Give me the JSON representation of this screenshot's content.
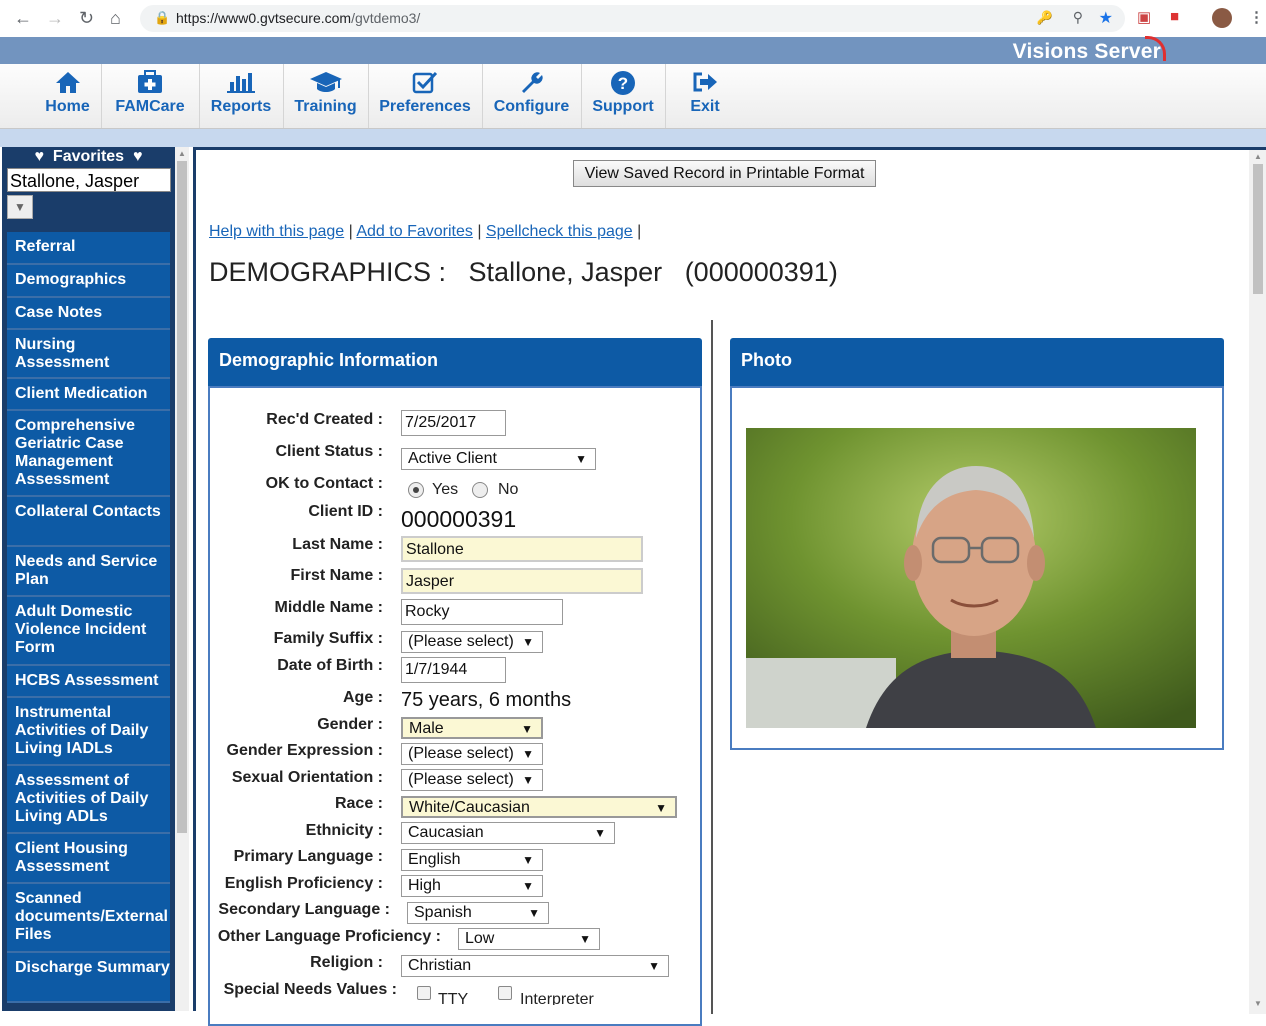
{
  "browser": {
    "url_host": "https://www0.gvtsecure.com",
    "url_path": "/gvtdemo3/"
  },
  "banner": {
    "brand": "Visions Server"
  },
  "toolbar": [
    {
      "label": "Home",
      "icon": "home-icon"
    },
    {
      "label": "FAMCare",
      "icon": "medkit-icon"
    },
    {
      "label": "Reports",
      "icon": "bar-chart-icon"
    },
    {
      "label": "Training",
      "icon": "graduation-cap-icon"
    },
    {
      "label": "Preferences",
      "icon": "checkbox-icon"
    },
    {
      "label": "Configure",
      "icon": "wrench-icon"
    },
    {
      "label": "Support",
      "icon": "question-icon"
    },
    {
      "label": "Exit",
      "icon": "exit-icon"
    }
  ],
  "favorites": {
    "title": "Favorites",
    "value": "Stallone, Jasper"
  },
  "sidebar": {
    "items": [
      {
        "label": "Referral"
      },
      {
        "label": "Demographics"
      },
      {
        "label": "Case Notes"
      },
      {
        "label": "Nursing Assessment"
      },
      {
        "label": "Client Medication"
      },
      {
        "label": "Comprehensive Geriatric Case Management Assessment"
      },
      {
        "label": "Collateral Contacts"
      },
      {
        "label": "Needs and Service Plan"
      },
      {
        "label": "Adult Domestic Violence Incident Form"
      },
      {
        "label": "HCBS Assessment"
      },
      {
        "label": "Instrumental Activities of Daily Living IADLs"
      },
      {
        "label": "Assessment of Activities of Daily Living ADLs"
      },
      {
        "label": "Client Housing Assessment"
      },
      {
        "label": "Scanned documents/External Files"
      },
      {
        "label": "Discharge Summary"
      }
    ]
  },
  "main": {
    "print_button": "View Saved Record in Printable Format",
    "help_links": [
      "Help with this page",
      "Add to Favorites",
      "Spellcheck this page"
    ],
    "separator": "|",
    "title_section": "DEMOGRAPHICS :",
    "title_name": "Stallone, Jasper",
    "title_id": "(000000391)"
  },
  "panels": {
    "demographic": "Demographic Information",
    "photo": "Photo"
  },
  "form": {
    "recd_created": {
      "label": "Rec'd Created :",
      "value": "7/25/2017"
    },
    "client_status": {
      "label": "Client Status :",
      "value": "Active Client"
    },
    "ok_to_contact": {
      "label": "OK to Contact :",
      "yes": "Yes",
      "no": "No",
      "selected": "Yes"
    },
    "client_id": {
      "label": "Client ID :",
      "value": "000000391"
    },
    "last_name": {
      "label": "Last Name :",
      "value": "Stallone"
    },
    "first_name": {
      "label": "First Name :",
      "value": "Jasper"
    },
    "middle_name": {
      "label": "Middle Name :",
      "value": "Rocky"
    },
    "family_suffix": {
      "label": "Family Suffix :",
      "value": "(Please select)"
    },
    "dob": {
      "label": "Date of Birth :",
      "value": "1/7/1944"
    },
    "age": {
      "label": "Age :",
      "value": "75 years, 6 months"
    },
    "gender": {
      "label": "Gender :",
      "value": "Male"
    },
    "gender_expression": {
      "label": "Gender Expression :",
      "value": "(Please select)"
    },
    "sexual_orientation": {
      "label": "Sexual Orientation :",
      "value": "(Please select)"
    },
    "race": {
      "label": "Race :",
      "value": "White/Caucasian"
    },
    "ethnicity": {
      "label": "Ethnicity :",
      "value": "Caucasian"
    },
    "primary_language": {
      "label": "Primary Language :",
      "value": "English"
    },
    "english_proficiency": {
      "label": "English Proficiency :",
      "value": "High"
    },
    "secondary_language": {
      "label": "Secondary Language :",
      "value": "Spanish"
    },
    "other_lang_prof": {
      "label": "Other Language Proficiency :",
      "value": "Low"
    },
    "religion": {
      "label": "Religion :",
      "value": "Christian"
    },
    "special_needs": {
      "label": "Special Needs Values :",
      "options": [
        "TTY",
        "Interpreter"
      ]
    }
  },
  "colors": {
    "accent": "#0d5aa5",
    "sidebar_bg": "#1a3d6a",
    "required_bg": "#fbf8d4"
  }
}
